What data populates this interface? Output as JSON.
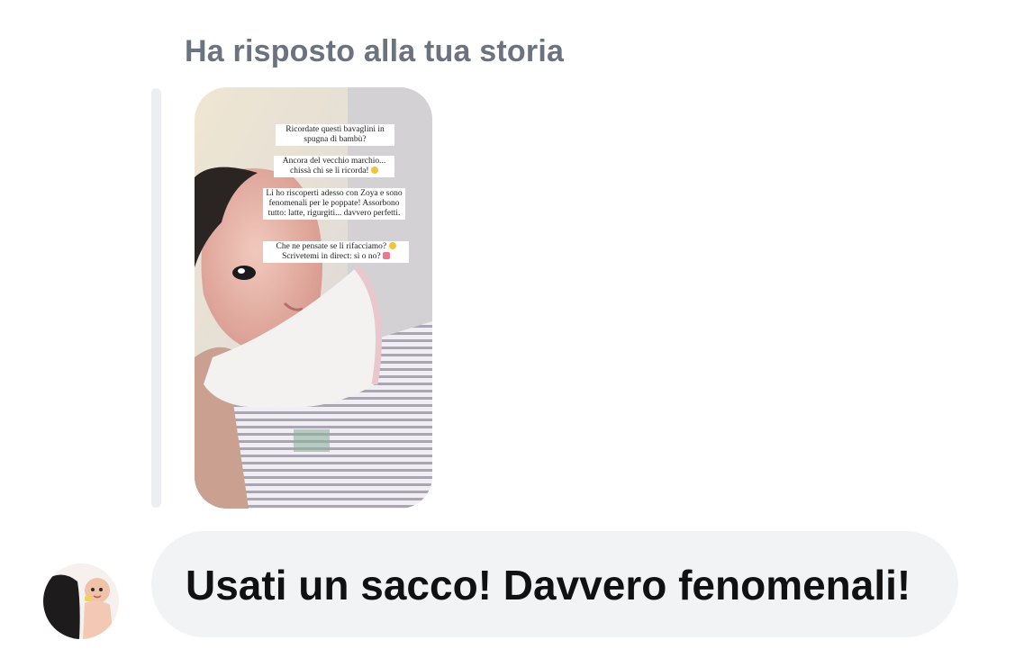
{
  "reply": {
    "label": "Ha risposto alla tua storia"
  },
  "story": {
    "captions": {
      "c1": "Ricordate questi bavaglini in spugna di bambù?",
      "c2": "Ancora del vecchio marchio... chissà chi se li ricorda!",
      "c3": "Li ho riscoperti adesso con Zoya e sono fenomenali per le poppate! Assorbono tutto: latte, rigurgiti... davvero perfetti.",
      "c4_line1": "Che ne pensate se li rifacciamo?",
      "c4_line2": "Scrivetemi in direct: sì o no?"
    }
  },
  "message": {
    "text": "Usati un sacco! Davvero fenomenali!"
  },
  "icons": {
    "avatar": "user-avatar",
    "emoji_smile": "smile-emoji",
    "emoji_heart": "heart-emoji"
  }
}
